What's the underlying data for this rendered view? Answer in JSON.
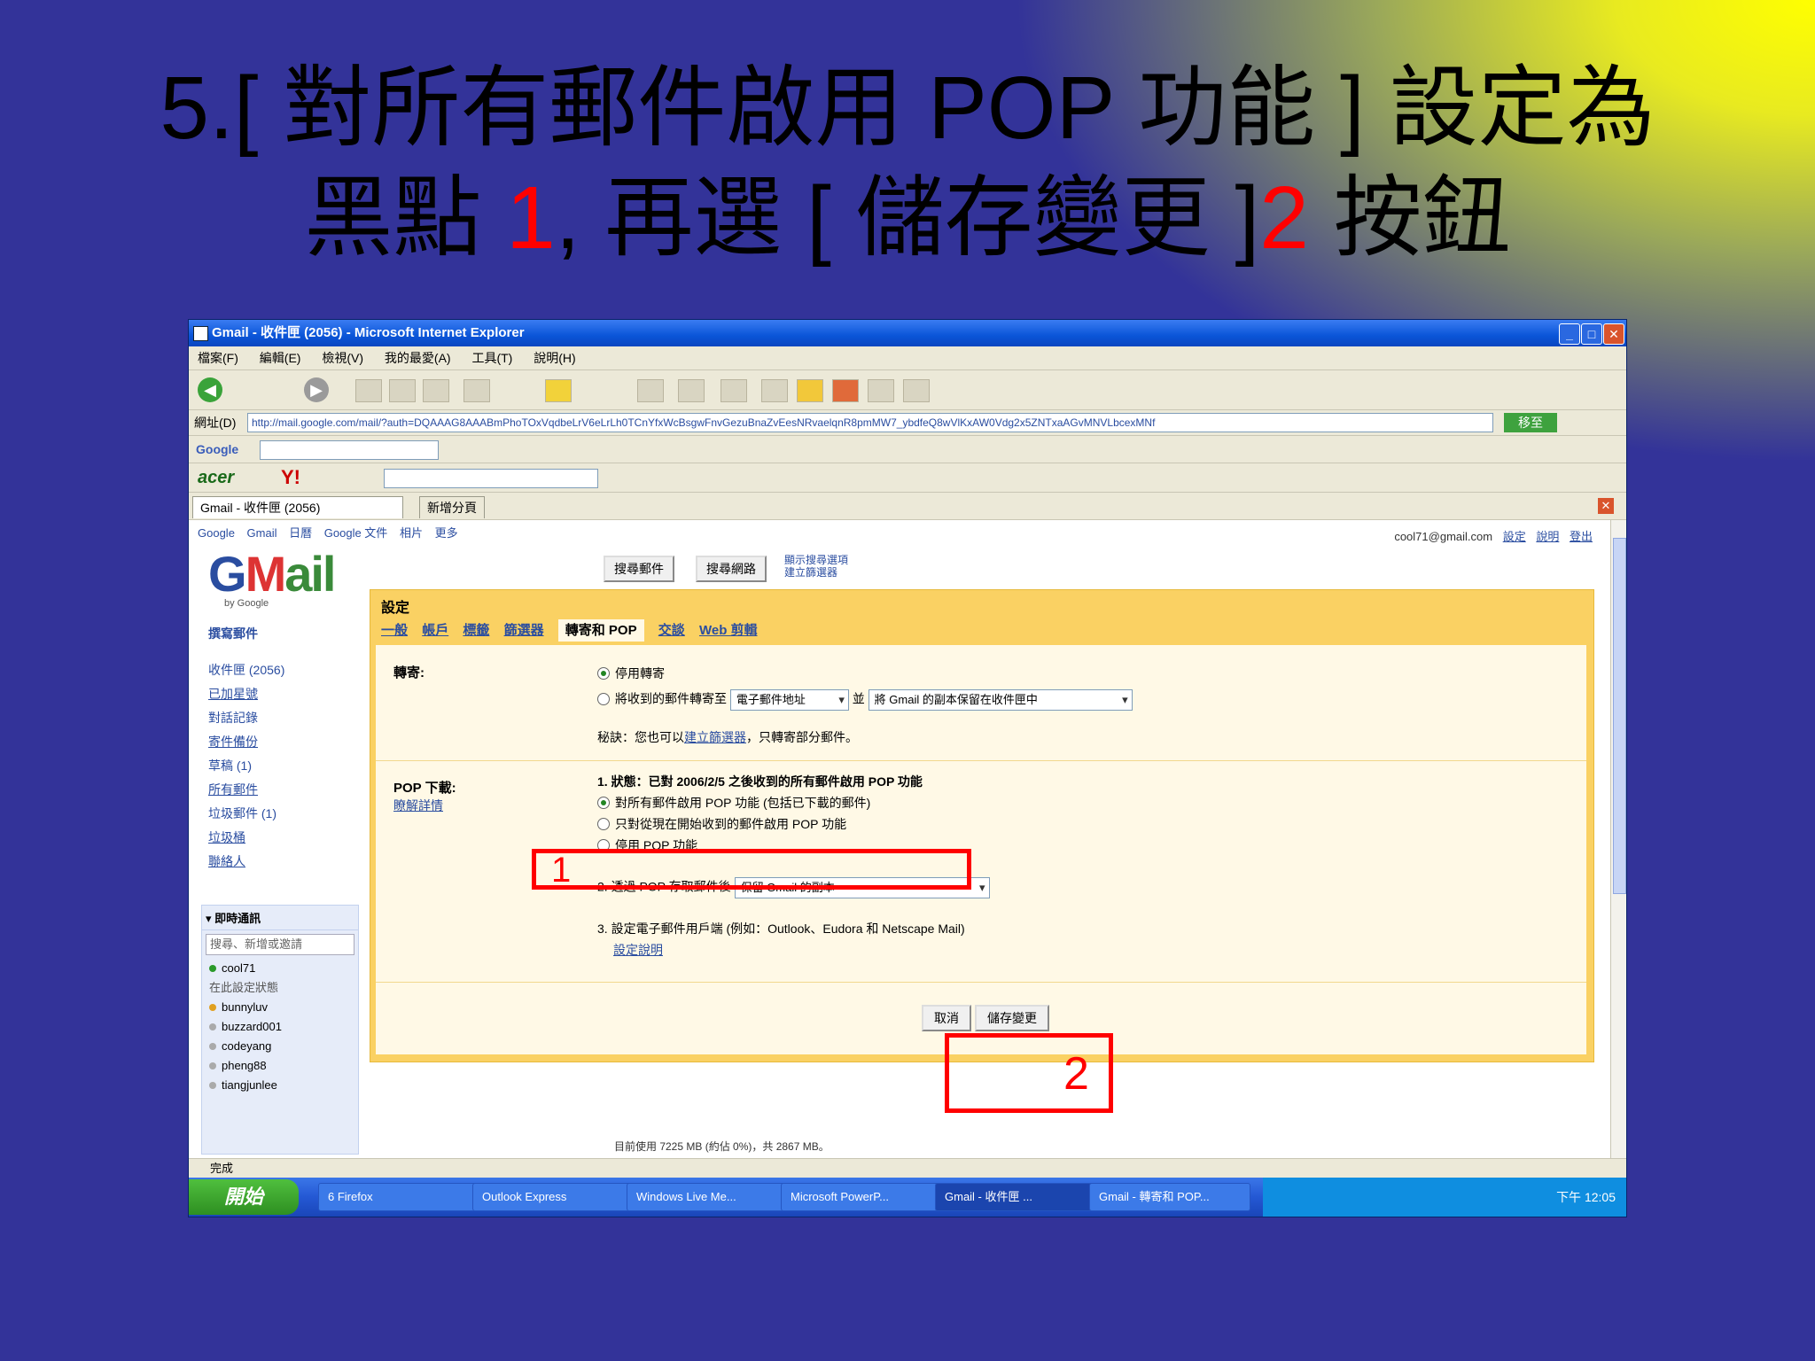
{
  "slide": {
    "title_line1": "5.[ 對所有郵件啟用 POP 功能 ] 設定為",
    "title_line2_a": "黑點 ",
    "title_line2_b": "1",
    "title_line2_c": ", 再選 [ 儲存變更 ]",
    "title_line2_d": "2",
    "title_line2_e": " 按鈕",
    "highlight_color": "#ff0000"
  },
  "browser": {
    "window_title": "Gmail - 收件匣 (2056) - Microsoft Internet Explorer",
    "menus": [
      "檔案(F)",
      "編輯(E)",
      "檢視(V)",
      "我的最愛(A)",
      "工具(T)",
      "說明(H)"
    ],
    "address_label": "網址(D)",
    "address_url": "http://mail.google.com/mail/?auth=DQAAAG8AAABmPhoTOxVqdbeLrV6eLrLh0TCnYfxWcBsgwFnvGezuBnaZvEesNRvaelqnR8pmMW7_ybdfeQ8wVlKxAW0Vdg2x5ZNTxaAGvMNVLbcexMNf",
    "go_label": "移至",
    "google_toolbar_label": "Google",
    "tabs": [
      "Gmail - 收件匣 (2056)",
      "新增分頁"
    ],
    "status_text": "完成"
  },
  "gmail": {
    "top_links": [
      "Google",
      "Gmail",
      "日曆",
      "Google 文件",
      "相片",
      "更多"
    ],
    "account": "cool71@gmail.com",
    "account_links": [
      "設定",
      "說明",
      "登出"
    ],
    "logo": {
      "g": "G",
      "m": "M",
      "ail": "ail",
      "by": "by Google"
    },
    "search_mail": "搜尋郵件",
    "search_web": "搜尋網路",
    "search_options": [
      "顯示搜尋選項",
      "建立篩選器"
    ],
    "compose": "撰寫郵件",
    "nav": [
      {
        "label": "收件匣 (2056)",
        "plain": true
      },
      {
        "label": "已加星號",
        "plain": false
      },
      {
        "label": "對話記錄",
        "plain": true
      },
      {
        "label": "寄件備份",
        "plain": false
      },
      {
        "label": "草稿 (1)",
        "plain": true
      },
      {
        "label": "所有郵件",
        "plain": false
      },
      {
        "label": "垃圾郵件 (1)",
        "plain": true
      },
      {
        "label": "垃圾桶",
        "plain": false
      },
      {
        "label": "聯絡人",
        "plain": false
      }
    ],
    "chat": {
      "header": "▾ 即時通訊",
      "search_placeholder": "搜尋、新增或邀請",
      "me": "cool71",
      "me_status": "在此設定狀態",
      "contacts": [
        "bunnyluv",
        "buzzard001",
        "codeyang",
        "pheng88",
        "tiangjunlee"
      ]
    }
  },
  "settings": {
    "title": "設定",
    "tabs": [
      "一般",
      "帳戶",
      "標籤",
      "篩選器",
      "轉寄和 POP",
      "交談",
      "Web 剪輯"
    ],
    "active_tab": "轉寄和 POP",
    "forwarding": {
      "label": "轉寄:",
      "opt_off": "停用轉寄",
      "opt_on": "將收到的郵件轉寄至",
      "forward_to": "電子郵件地址",
      "and": "並",
      "keep_copy": "將 Gmail 的副本保留在收件匣中",
      "tip_a": "秘訣：您也可以",
      "tip_link": "建立篩選器",
      "tip_b": "，只轉寄部分郵件。"
    },
    "pop": {
      "label": "POP 下載:",
      "learn_more": "瞭解詳情",
      "step1": "1. 狀態：已對 2006/2/5 之後收到的所有郵件啟用 POP 功能",
      "opt_all": "對所有郵件啟用 POP 功能 (包括已下載的郵件)",
      "opt_new": "只對從現在開始收到的郵件啟用 POP 功能",
      "opt_disable": "停用 POP 功能",
      "step2": "2. 透過 POP 存取郵件後",
      "step2_select": "保留 Gmail 的副本",
      "step3": "3. 設定電子郵件用戶端 (例如：Outlook、Eudora 和 Netscape Mail)",
      "config_link": "設定說明"
    },
    "cancel": "取消",
    "save": "儲存變更"
  },
  "footer_note": "目前使用 7225 MB (約佔 0%)，共 2867 MB。",
  "taskbar": {
    "start": "開始",
    "items": [
      "6 Firefox",
      "Outlook Express",
      "Windows Live Me...",
      "Microsoft PowerP...",
      "Gmail - 收件匣 ...",
      "Gmail - 轉寄和 POP..."
    ],
    "clock": "下午 12:05"
  },
  "callouts": {
    "one": "1",
    "two": "2"
  }
}
